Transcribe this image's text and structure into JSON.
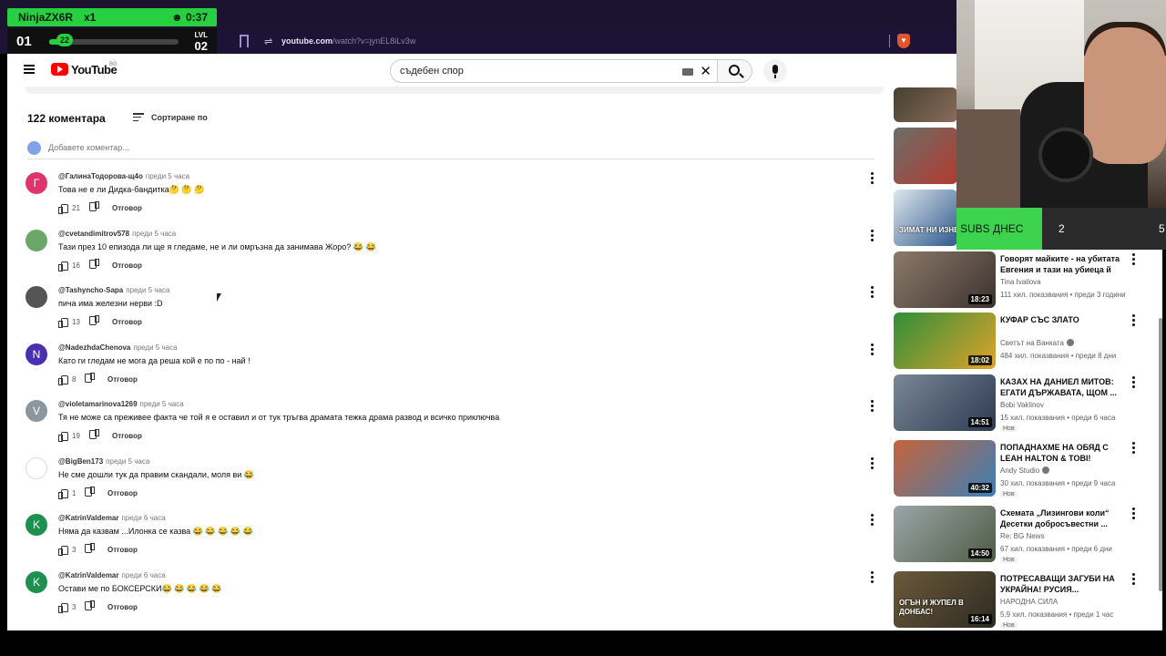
{
  "overlay": {
    "player": "NinjaZX6R",
    "multiplier": "x1",
    "timer": "0:37",
    "stage": "01",
    "progress_value": "22",
    "level_label": "LVL",
    "level": "02"
  },
  "browser": {
    "url_host": "youtube.com",
    "url_path": "/watch?v=jynEL8iLv3w"
  },
  "youtube": {
    "logo_text": "YouTube",
    "country_code": "BG",
    "search_query": "съдебен спор"
  },
  "comments": {
    "count_label": "122 коментара",
    "sort_label": "Сортиране по",
    "add_placeholder": "Добавете коментар...",
    "reply_label": "Отговор",
    "items": [
      {
        "initial": "Г",
        "color": "#e0356a",
        "author": "@ГалинаТодорова-щ4о",
        "time": "преди 5 часа",
        "text": "Това не е ли Дидка-бандитка🤔 🤔 🤔",
        "likes": "21"
      },
      {
        "initial": "",
        "color": "#6aa86a",
        "author": "@cvetandimitrov578",
        "time": "преди 5 часа",
        "text": "Тази през 10 епизода ли ще я гледаме, не и ли омръзна да занимава Жоро? 😂 😂",
        "likes": "16"
      },
      {
        "initial": "",
        "color": "#555555",
        "author": "@Tashyncho-Sapa",
        "time": "преди 5 часа",
        "text": "пича има железни нерви :D",
        "likes": "13"
      },
      {
        "initial": "N",
        "color": "#4a2fb0",
        "author": "@NadezhdaChenova",
        "time": "преди 5 часа",
        "text": "Като ги гледам не мога да реша кой е по по - най !",
        "likes": "8"
      },
      {
        "initial": "V",
        "color": "#8a97a0",
        "author": "@violetamarinova1269",
        "time": "преди 5 часа",
        "text": "Тя не може са преживее факта че той я е оставил и от тук тръгва драмата тежка драма развод и всичко приключва",
        "likes": "19"
      },
      {
        "initial": "",
        "color": "#ffffff",
        "author": "@BigBen173",
        "time": "преди 5 часа",
        "text": "Не сме дошли тук да правим скандали, моля ви 😂",
        "likes": "1"
      },
      {
        "initial": "K",
        "color": "#1e8f4e",
        "author": "@KatrinValdemar",
        "time": "преди 6 часа",
        "text": "Няма да казвам ...Илонка се казва 😂 😂 😂 😂 😂",
        "likes": "3"
      },
      {
        "initial": "K",
        "color": "#1e8f4e",
        "author": "@KatrinValdemar",
        "time": "преди 6 часа",
        "text": "Остави ме по БОКСЕРСКИ😂 😂 😂 😂 😂",
        "likes": "3"
      }
    ]
  },
  "recommendations": [
    {
      "title": "",
      "channel": "",
      "meta": "",
      "duration": "",
      "thumb_colors": [
        "#45402f",
        "#8a6c5c"
      ]
    },
    {
      "title": "",
      "channel": "",
      "meta": "",
      "duration": "",
      "thumb_colors": [
        "#6a6f6a",
        "#b43a2e"
      ]
    },
    {
      "title": "",
      "channel": "",
      "meta": "",
      "duration": "",
      "thumb_colors": [
        "#dfe6ee",
        "#2e5a8c"
      ],
      "overlay_text": "ЗИМАТ НИ ИЗНЕН"
    },
    {
      "title": "Говорят майките - на убитата Евгения и тази на убиеца й",
      "channel": "Tina Ivailova",
      "meta": "111 хил. показвания • преди 3 години",
      "duration": "18:23",
      "thumb_colors": [
        "#8c7a68",
        "#3b3330"
      ]
    },
    {
      "title": "КУФАР СЪС ЗЛАТО",
      "channel": "Светът на Ванката",
      "verified": true,
      "meta": "484 хил. показвания • преди 8 дни",
      "duration": "18:02",
      "thumb_colors": [
        "#2f8f3a",
        "#e0a22b"
      ]
    },
    {
      "title": "КАЗАХ НА ДАНИЕЛ МИТОВ: ЕГАТИ ДЪРЖАВАТА, ЩОМ ...",
      "channel": "Bobi Vaklinov",
      "meta": "15 хил. показвания • преди 6 часа",
      "new": "Нов",
      "duration": "14:51",
      "thumb_colors": [
        "#7a8796",
        "#2d3a52"
      ]
    },
    {
      "title": "ПОПАДНАХМЕ НА ОБЯД С LEAH HALTON & TOBI!",
      "channel": "Andy Studio",
      "verified": true,
      "meta": "30 хил. показвания • преди 9 часа",
      "new": "Нов",
      "duration": "40:32",
      "thumb_colors": [
        "#c5643a",
        "#3c7fb8"
      ]
    },
    {
      "title": "Схемата „Лизингови коли“ Десетки добросъвестни ...",
      "channel": "Re: BG News",
      "meta": "67 хил. показвания • преди 6 дни",
      "new": "Нов",
      "duration": "14:50",
      "thumb_colors": [
        "#9aa6a8",
        "#4f5b43"
      ]
    },
    {
      "title": "ПОТРЕСАВАЩИ ЗАГУБИ НА УКРАЙНА! РУСИЯ...",
      "channel": "НАРОДНА СИЛА",
      "meta": "5,9 хил. показвания • преди 1 час",
      "new": "Нов",
      "duration": "16:14",
      "thumb_colors": [
        "#6b5a3a",
        "#2e2a22"
      ],
      "overlay_text": "ОГЪН И ЖУПЕЛ В ДОНБАС!"
    }
  ],
  "subs": {
    "label": "SUBS ДНЕС",
    "today": "2",
    "goal": "5"
  }
}
